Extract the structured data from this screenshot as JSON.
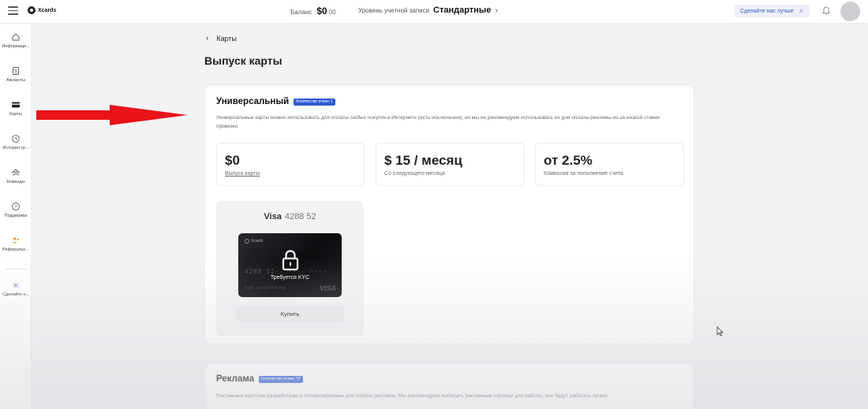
{
  "topbar": {
    "logo_text": "Xcards",
    "balance_label": "Баланс",
    "balance_value": "$0",
    "balance_cents": ".00",
    "tier_label": "Уровень учетной записи",
    "tier_value": "Стандартные",
    "feedback_text": "Сделайте нас лучше",
    "feedback_close": "×"
  },
  "sidebar": {
    "items": [
      {
        "label": "Информаци...",
        "icon": "home-icon"
      },
      {
        "label": "Аккаунты",
        "icon": "dollar-doc-icon"
      },
      {
        "label": "Карты",
        "icon": "card-icon"
      },
      {
        "label": "История тр...",
        "icon": "history-icon"
      },
      {
        "label": "Команды",
        "icon": "team-icon"
      },
      {
        "label": "Поддержка",
        "icon": "help-icon"
      },
      {
        "label": "Реферальн...",
        "icon": "referral-icon"
      },
      {
        "label": "Сделайте н...",
        "icon": "feedback-icon"
      }
    ]
  },
  "main": {
    "back_label": "Карты",
    "page_title": "Выпуск карты",
    "universal": {
      "title": "Универсальный",
      "badge": "Количество ячеек: 1",
      "description": "Универсальные карты можно использовать для оплаты любых покупок в Интернете (есть исключения), но мы не рекомендуем использовать их для оплаты рекламы из-за низкой ставки привязки",
      "stats": [
        {
          "value": "$0",
          "caption": "Выпуск карты"
        },
        {
          "value": "$ 15 / месяц",
          "caption": "Со следующего месяца"
        },
        {
          "value": "от 2.5%",
          "caption": "Комиссия за пополнение счета"
        }
      ],
      "product": {
        "network": "Visa",
        "bin": "4288 52",
        "card_brand": "Xcards",
        "card_number": "4288 52·· ···· ····",
        "card_holder": "РИК ЕРЕМЯННЫ",
        "card_visa": "VISA",
        "kyc_text": "Требуется KYC",
        "buy_label": "Купить"
      }
    },
    "ads": {
      "title": "Реклама",
      "badge": "Количество ячеек: 37",
      "description": "Рекламные карточки разработаны и оптимизированы для оплаты рекламы. Мы рекомендуем выбирать рекламные корзины для работы, они будут работать лучше."
    }
  },
  "colors": {
    "accent": "#2f5bd3",
    "annotation_arrow": "#e8141a"
  }
}
